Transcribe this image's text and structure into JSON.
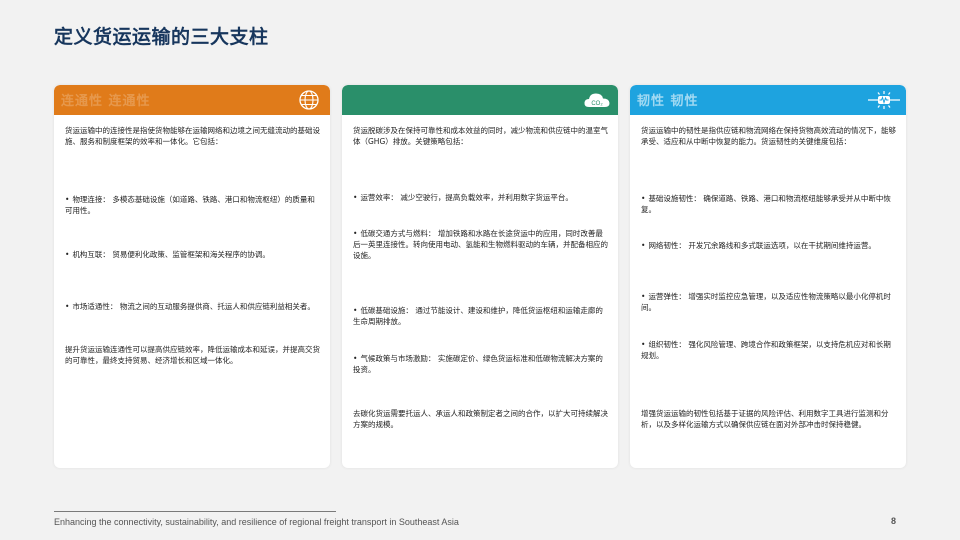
{
  "title": "定义货运运输的三大支柱",
  "colors": {
    "title": "#17365d",
    "connectivity": "#e07b1a",
    "sustainability": "#2a8f6a",
    "resilience": "#1ea3df"
  },
  "pillars": [
    {
      "header": "连通性 连通性",
      "icon": "globe-icon",
      "intro": "货运运输中的连接性是指使货物能够在运输网络和边境之间无缝流动的基础设施、服务和制度框架的效率和一体化。它包括：",
      "items": [
        "物理连接： 多模态基础设施（如道路、铁路、港口和物流枢纽）的质量和可用性。",
        "机构互联： 贸易便利化政策、监管框架和海关程序的协调。",
        "市场适通性： 物流之间的互动服务提供商、托运人和供应链利益相关者。"
      ],
      "outro": "提升货运运输连通性可以提高供应链效率，降低运输成本和延误，并提高交货的可靠性，最终支持贸易、经济增长和区域一体化。"
    },
    {
      "header": "",
      "icon": "co2-cloud-icon",
      "icon_label": "CO₂",
      "intro": "货运脱碳涉及在保持可靠性和成本效益的同时，减少物流和供应链中的温室气体（GHG）排放。关键策略包括：",
      "items": [
        "运营效率： 减少空驶行，提高负载效率，并利用数字货运平台。",
        "低碳交通方式与燃料： 增加铁路和水路在长途货运中的应用，同时改善最后一英里连接性。转向使用电动、氢能和生物燃料驱动的车辆，并配备相应的设施。",
        "低碳基础设施： 通过节能设计、建设和维护，降低货运枢纽和运输走廊的生命周期排放。",
        "气候政策与市场激励： 实施碳定价、绿色货运标准和低碳物流解决方案的投资。"
      ],
      "outro": "去碳化货运需要托运人、承运人和政策制定者之间的合作，以扩大可持续解决方案的规模。"
    },
    {
      "header": "韧性 韧性",
      "icon": "resilience-signal-icon",
      "intro": "货运运输中的韧性是指供应链和物流网络在保持货物高效流动的情况下，能够承受、适应和从中断中恢复的能力。货运韧性的关键维度包括：",
      "items": [
        "基础设施韧性： 确保道路、铁路、港口和物流枢纽能够承受并从中断中恢复。",
        "网络韧性： 开发冗余路线和多式联运选项，以在干扰期间维持运营。",
        "运营弹性： 增强实时监控应急管理，以及适应性物流策略以最小化停机时间。",
        "组织韧性： 强化风险管理、跨境合作和政策框架，以支持危机应对和长期规划。"
      ],
      "outro": "增强货运运输的韧性包括基于证据的风险评估、利用数字工具进行监测和分析，以及多样化运输方式以确保供应链在面对外部冲击时保持稳健。"
    }
  ],
  "footer": {
    "text": "Enhancing the connectivity, sustainability, and resilience of regional freight transport in Southeast Asia",
    "page": "8"
  }
}
